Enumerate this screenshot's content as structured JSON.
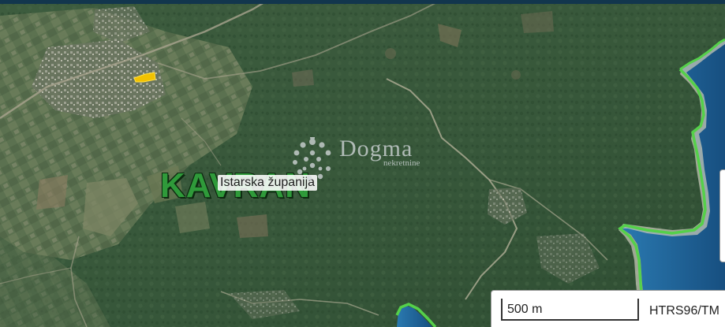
{
  "map": {
    "place_label": "KAVRAN",
    "region_label": "Istarska županija",
    "colors": {
      "sea": "#1c5f93",
      "coast_line": "#55d04a",
      "parcel": "#f2c200",
      "forest": "#3a5a3b",
      "place_label": "#2f9a3a"
    }
  },
  "watermark": {
    "name": "Dogma",
    "subtitle": "nekretnine"
  },
  "scale": {
    "distance_label": "500 m",
    "crs_label": "HTRS96/TM"
  },
  "icons": {
    "watermark_logo": "dogma-logo-icon"
  }
}
